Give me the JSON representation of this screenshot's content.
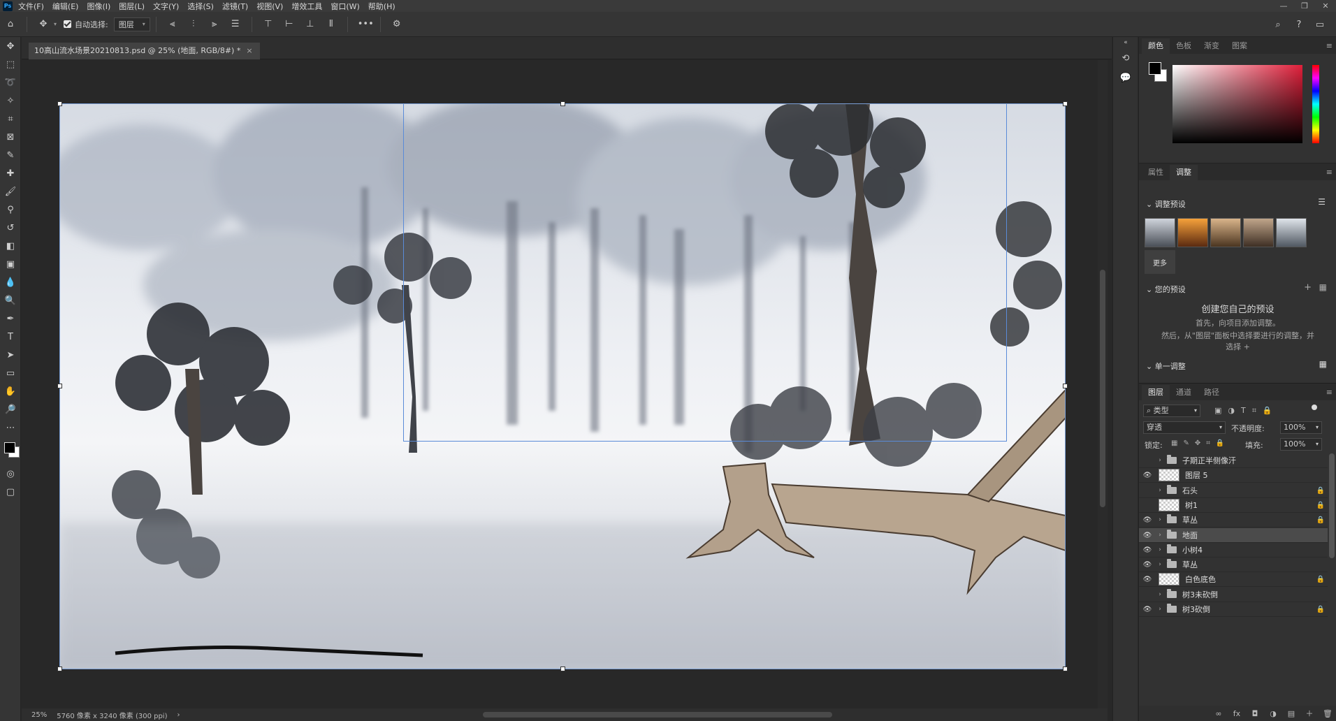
{
  "app": {
    "logo": "Ps",
    "menus": [
      "文件(F)",
      "编辑(E)",
      "图像(I)",
      "图层(L)",
      "文字(Y)",
      "选择(S)",
      "滤镜(T)",
      "视图(V)",
      "增效工具",
      "窗口(W)",
      "帮助(H)"
    ],
    "window_controls": [
      "—",
      "❐",
      "✕"
    ]
  },
  "options": {
    "auto_select_label": "自动选择:",
    "auto_select_target": "图层",
    "icons": [
      "home-icon",
      "move-icon",
      "align-left-icon",
      "align-center-icon",
      "align-right-icon",
      "distribute-icon",
      "align-top-icon",
      "align-middle-icon",
      "align-bottom-icon",
      "more-icon",
      "gear-icon",
      "search-icon",
      "help-icon",
      "workspace-icon"
    ]
  },
  "document": {
    "tab_title": "10高山流水场景20210813.psd @ 25% (地面, RGB/8#) *",
    "close": "×"
  },
  "status": {
    "zoom": "25%",
    "info": "5760 像素 x 3240 像素 (300 ppi)",
    "arrow": "›"
  },
  "color_panel": {
    "tabs": [
      "颜色",
      "色板",
      "渐变",
      "图案"
    ],
    "active_tab": "颜色",
    "hue_color": "#e01f3a"
  },
  "adjust_panel": {
    "tabs": [
      "属性",
      "调整"
    ],
    "active_tab": "调整",
    "presets_header": "调整预设",
    "more_label": "更多",
    "your_presets_header": "您的预设",
    "create_title": "创建您自己的预设",
    "create_line1": "首先，向项目添加调整。",
    "create_line2": "然后，从\"图层\"面板中选择要进行的调整，并",
    "create_line3": "选择 +",
    "single_adjust_header": "单一调整"
  },
  "layers_panel": {
    "tabs": [
      "图层",
      "通道",
      "路径"
    ],
    "active_tab": "图层",
    "filter_label": "类型",
    "blend_mode": "穿透",
    "opacity_label": "不透明度:",
    "opacity_value": "100%",
    "lock_label": "锁定:",
    "fill_label": "填充:",
    "fill_value": "100%",
    "layers": [
      {
        "name": "子期正半侧像汗",
        "type": "group",
        "visible": false,
        "locked": false,
        "selected": false
      },
      {
        "name": "图层 5",
        "type": "layer",
        "visible": true,
        "locked": false,
        "selected": false
      },
      {
        "name": "石头",
        "type": "group",
        "visible": false,
        "locked": true,
        "selected": false
      },
      {
        "name": "树1",
        "type": "layer",
        "visible": false,
        "locked": true,
        "selected": false
      },
      {
        "name": "草丛",
        "type": "group",
        "visible": true,
        "locked": true,
        "selected": false
      },
      {
        "name": "地面",
        "type": "group",
        "visible": true,
        "locked": false,
        "selected": true
      },
      {
        "name": "小树4",
        "type": "group",
        "visible": true,
        "locked": false,
        "selected": false
      },
      {
        "name": "草丛",
        "type": "group",
        "visible": true,
        "locked": false,
        "selected": false
      },
      {
        "name": "白色底色",
        "type": "layer",
        "visible": true,
        "locked": true,
        "selected": false
      },
      {
        "name": "树3未砍倒",
        "type": "group",
        "visible": false,
        "locked": false,
        "selected": false
      },
      {
        "name": "树3砍倒",
        "type": "group",
        "visible": true,
        "locked": true,
        "selected": false
      }
    ],
    "footer_icons": [
      "∞",
      "fx",
      "◘",
      "◑",
      "▤",
      "＋",
      "🗑"
    ]
  }
}
